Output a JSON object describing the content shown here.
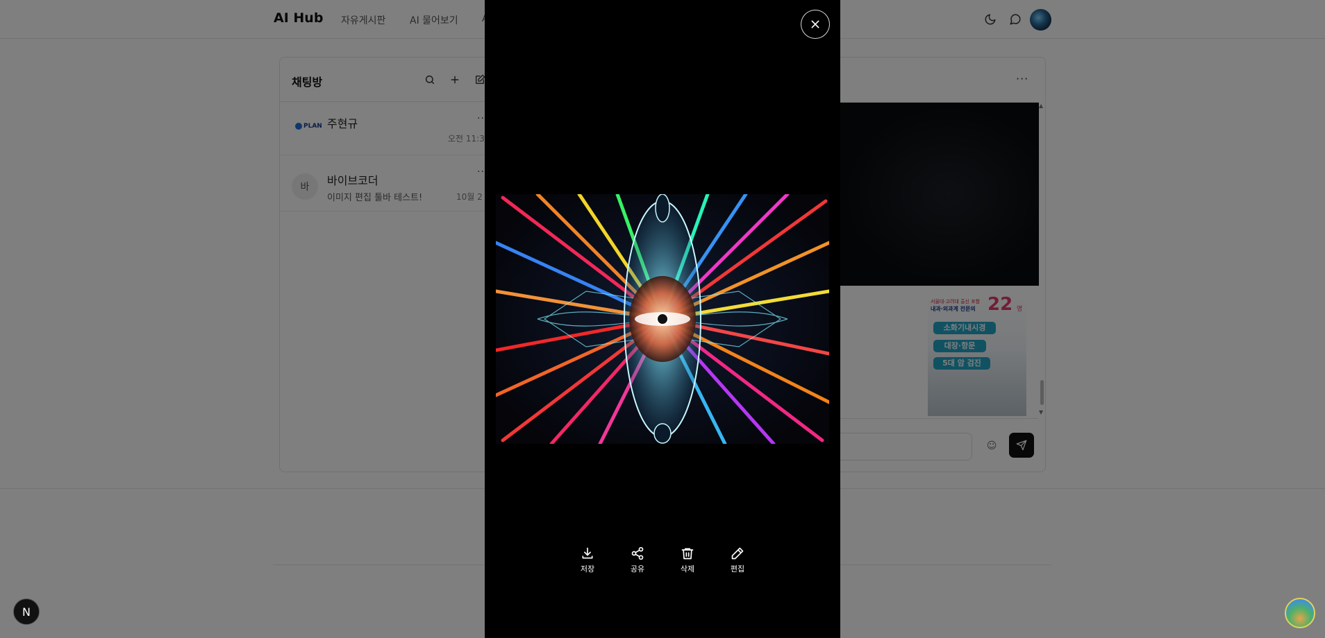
{
  "app": {
    "title": "AI Hub"
  },
  "nav": {
    "items": [
      {
        "label": "자유게시판"
      },
      {
        "label": "AI 물어보기"
      },
      {
        "label": "A"
      }
    ]
  },
  "header_icons": {
    "theme": "moon-icon",
    "messages": "chat-bubble-icon",
    "profile": "avatar"
  },
  "sidebar": {
    "title": "채팅방",
    "icons": [
      "search-icon",
      "plus-icon",
      "edit-icon"
    ],
    "rooms": [
      {
        "name": "주현규",
        "time": "오전 11:3",
        "more": "···",
        "avatar_logo_text": "PLAN"
      },
      {
        "name": "바이브코더",
        "avatar_text": "바",
        "preview": "이미지 편집 툴바 테스트!",
        "time": "10월 2",
        "more": "···"
      }
    ]
  },
  "chat": {
    "more": "···",
    "ad": {
      "line1": "서울대·고려대 출신 포함",
      "line2": "내과·외과계 전문의",
      "number": "22",
      "unit": "명",
      "tags": [
        "소화기내시경",
        "대장·항문",
        "5대 암 검진"
      ]
    },
    "emoji": "☺"
  },
  "viewer": {
    "close_icon": "close-icon",
    "actions": [
      {
        "label": "저장",
        "icon": "download-icon"
      },
      {
        "label": "공유",
        "icon": "share-icon"
      },
      {
        "label": "삭제",
        "icon": "trash-icon"
      },
      {
        "label": "편집",
        "icon": "pencil-icon"
      }
    ]
  },
  "badge": {
    "letter": "N"
  },
  "colors": {
    "accent": "#111111",
    "ad_pill": "#22a5c4",
    "ad_number": "#e63a6a"
  }
}
